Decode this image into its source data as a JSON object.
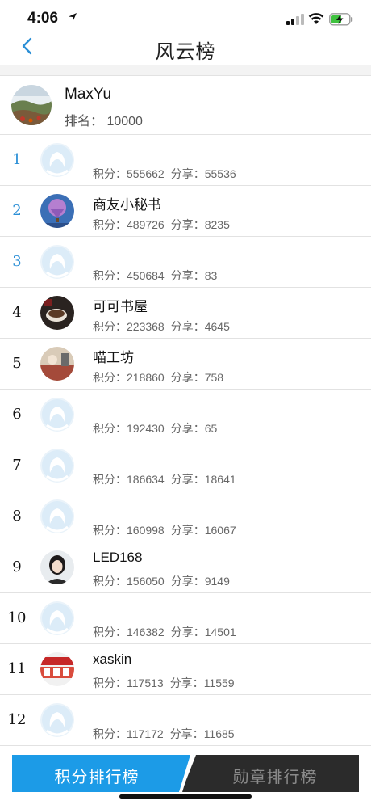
{
  "status_bar": {
    "time": "4:06"
  },
  "nav": {
    "title": "风云榜",
    "back_icon": "chevron-left-icon"
  },
  "me": {
    "name": "MaxYu",
    "rank": "排名：  10000",
    "avatar": "landscape-photo"
  },
  "labels": {
    "score": "积分：",
    "share": "分享："
  },
  "rows": [
    {
      "rank": "1",
      "name": "",
      "score": "555662",
      "share": "55536",
      "avatar": "default"
    },
    {
      "rank": "2",
      "name": "商友小秘书",
      "score": "489726",
      "share": "8235",
      "avatar": "balloon"
    },
    {
      "rank": "3",
      "name": "",
      "score": "450684",
      "share": "83",
      "avatar": "default"
    },
    {
      "rank": "4",
      "name": "可可书屋",
      "score": "223368",
      "share": "4645",
      "avatar": "dark"
    },
    {
      "rank": "5",
      "name": "喵工坊",
      "score": "218860",
      "share": "758",
      "avatar": "warm"
    },
    {
      "rank": "6",
      "name": "",
      "score": "192430",
      "share": "65",
      "avatar": "default"
    },
    {
      "rank": "7",
      "name": "",
      "score": "186634",
      "share": "18641",
      "avatar": "default"
    },
    {
      "rank": "8",
      "name": "",
      "score": "160998",
      "share": "16067",
      "avatar": "default"
    },
    {
      "rank": "9",
      "name": "LED168",
      "score": "156050",
      "share": "9149",
      "avatar": "person"
    },
    {
      "rank": "10",
      "name": "",
      "score": "146382",
      "share": "14501",
      "avatar": "default"
    },
    {
      "rank": "11",
      "name": "xaskin",
      "score": "117513",
      "share": "11559",
      "avatar": "red"
    },
    {
      "rank": "12",
      "name": "",
      "score": "117172",
      "share": "11685",
      "avatar": "default"
    }
  ],
  "tabs": {
    "active": "积分排行榜",
    "inactive": "勋章排行榜"
  },
  "colors": {
    "accent": "#1c9be7",
    "dark_tab": "#2b2b2b",
    "top_rank": "#2b8fd6"
  }
}
